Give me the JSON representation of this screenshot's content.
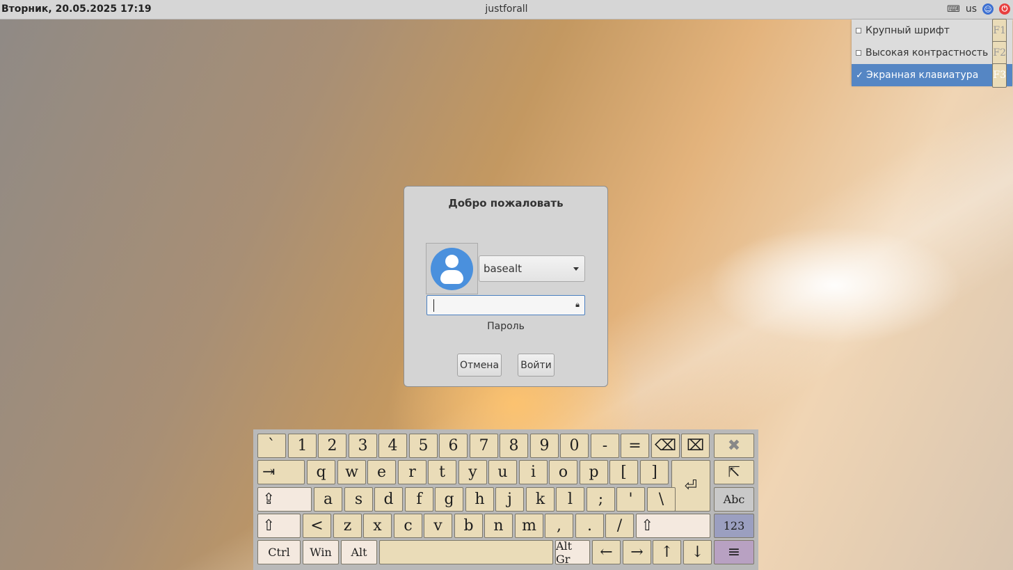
{
  "topbar": {
    "datetime": "Вторник, 20.05.2025 17:19",
    "hostname": "justforall",
    "keyboard_icon": "keyboard-icon",
    "layout": "us",
    "accessibility_icon": "accessibility-icon",
    "power_icon": "power-icon"
  },
  "a11y_menu": {
    "items": [
      {
        "label": "Крупный шрифт",
        "shortcut": "F1",
        "checked": false
      },
      {
        "label": "Высокая контрастность",
        "shortcut": "F2",
        "checked": false
      },
      {
        "label": "Экранная клавиатура",
        "shortcut": "F3",
        "checked": true
      }
    ]
  },
  "login": {
    "title": "Добро пожаловать",
    "user": "basealt",
    "password_value": "",
    "password_label": "Пароль",
    "cancel_label": "Отмена",
    "login_label": "Войти"
  },
  "keyboard": {
    "row1": [
      "`",
      "1",
      "2",
      "3",
      "4",
      "5",
      "6",
      "7",
      "8",
      "9",
      "0",
      "-",
      "=",
      "⌫",
      "⌧"
    ],
    "row2": [
      "⇥",
      "q",
      "w",
      "e",
      "r",
      "t",
      "y",
      "u",
      "i",
      "o",
      "p",
      "[",
      "]"
    ],
    "row3": [
      "⇪",
      "a",
      "s",
      "d",
      "f",
      "g",
      "h",
      "j",
      "k",
      "l",
      ";",
      "'",
      "\\"
    ],
    "row4": [
      "⇧",
      "<",
      "z",
      "x",
      "c",
      "v",
      "b",
      "n",
      "m",
      ",",
      ".",
      "/",
      "⇧"
    ],
    "row5": [
      "Ctrl",
      "Win",
      "Alt",
      "",
      "Alt Gr",
      "←",
      "→",
      "↑",
      "↓"
    ],
    "enter": "⏎",
    "side": [
      "✖",
      "⇱",
      "Abc",
      "123",
      "≡"
    ]
  },
  "colors": {
    "key_face": "#eadcb8",
    "menu_highlight": "#5586c4",
    "avatar": "#4a90dd"
  }
}
